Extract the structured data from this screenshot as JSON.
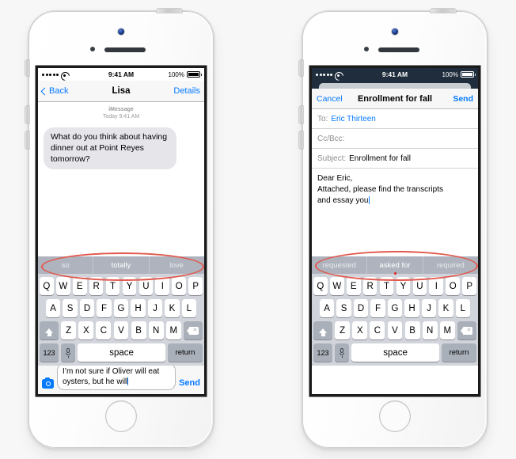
{
  "meta": {
    "accent_blue": "#057aff",
    "annotation_red": "#e2584d",
    "keyboard_bg": "#d1d4da",
    "predictive_bar_bg": "#aeb3bd",
    "bubble_gray": "#e5e5ea",
    "dark_statusbar": "#1f2d3d"
  },
  "phones": [
    {
      "id": "messages",
      "status_bar": {
        "carrier_dots": 5,
        "wifi_icon": "wifi-icon",
        "time": "9:41 AM",
        "battery_percent": "100%",
        "battery_icon": "battery-full-icon",
        "style": "light"
      },
      "nav": {
        "back_label": "Back",
        "back_icon": "chevron-left-icon",
        "title": "Lisa",
        "right_label": "Details"
      },
      "thread": {
        "service": "iMessage",
        "timestamp": "Today 9:41 AM",
        "messages": [
          {
            "from": "them",
            "text": "What do you think about having dinner out at Point Reyes tomorrow?"
          }
        ]
      },
      "compose": {
        "camera_icon": "camera-icon",
        "draft_text": "I’m not sure if Oliver will eat oysters, but he will",
        "send_label": "Send"
      },
      "predictive": [
        "so",
        "totally",
        "love"
      ],
      "predictive_selected_index": 1
    },
    {
      "id": "mail",
      "status_bar": {
        "carrier_dots": 5,
        "wifi_icon": "wifi-icon",
        "time": "9:41 AM",
        "battery_percent": "100%",
        "battery_icon": "battery-full-icon",
        "style": "dark"
      },
      "nav": {
        "cancel_label": "Cancel",
        "title": "Enrollment for fall",
        "send_label": "Send"
      },
      "fields": [
        {
          "label": "To:",
          "value": "Eric Thirteen",
          "is_link": true
        },
        {
          "label": "Cc/Bcc:",
          "value": "",
          "is_link": false
        },
        {
          "label": "Subject:",
          "value": "Enrollment for fall",
          "is_link": false
        }
      ],
      "body": {
        "line1": "Dear Eric,",
        "line2": "Attached, please find the transcripts",
        "line3": "and essay you"
      },
      "predictive": [
        "requested",
        "asked for",
        "required"
      ],
      "predictive_selected_index": 1
    }
  ],
  "keyboard": {
    "row1": [
      "Q",
      "W",
      "E",
      "R",
      "T",
      "Y",
      "U",
      "I",
      "O",
      "P"
    ],
    "row2": [
      "A",
      "S",
      "D",
      "F",
      "G",
      "H",
      "J",
      "K",
      "L"
    ],
    "row3": [
      "Z",
      "X",
      "C",
      "V",
      "B",
      "N",
      "M"
    ],
    "shift_icon": "shift-arrow-icon",
    "delete_icon": "delete-backspace-icon",
    "numbers_label": "123",
    "dictation_icon": "microphone-icon",
    "space_label": "space",
    "return_label": "return"
  }
}
